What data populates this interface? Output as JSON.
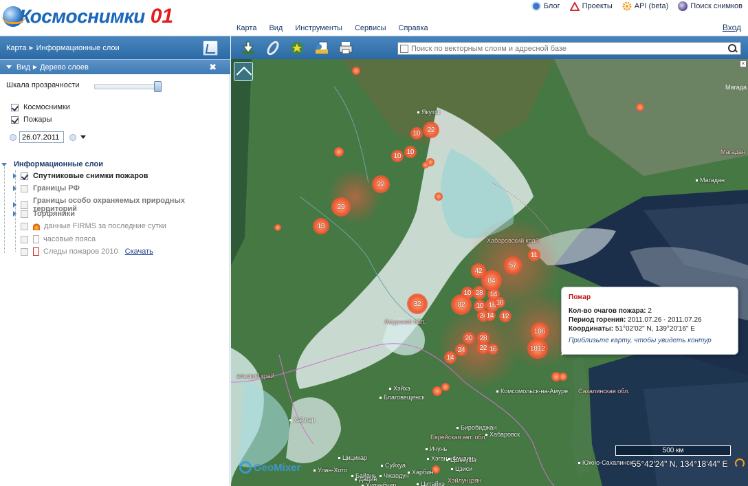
{
  "header": {
    "logo_text": "Космоснимки",
    "logo_number": "01",
    "links": [
      {
        "label": "Блог",
        "icon": "rss-icon",
        "color": "#3c78c8"
      },
      {
        "label": "Проекты",
        "icon": "triangle-icon",
        "color": "#d03030"
      },
      {
        "label": "API (beta)",
        "icon": "gear-icon",
        "color": "#f0a020"
      },
      {
        "label": "Поиск снимков",
        "icon": "globe-icon",
        "color": "#3060a0"
      }
    ],
    "menu": [
      "Карта",
      "Вид",
      "Инструменты",
      "Сервисы",
      "Справка"
    ],
    "exit_label": "Вход"
  },
  "left_panel": {
    "breadcrumb": [
      "Карта",
      "Информационные слои"
    ],
    "subheader": [
      "Вид",
      "Дерево слоев"
    ],
    "close_symbol": "✖",
    "transparency_label": "Шкала прозрачности",
    "transparency_value": 1.0,
    "base_layers": [
      {
        "label": "Космоснимки",
        "checked": true
      },
      {
        "label": "Пожары",
        "checked": true
      }
    ],
    "date_value": "26.07.2011",
    "tree_root": "Информационные слои",
    "layers": [
      {
        "label": "Спутниковые снимки пожаров",
        "checked": true,
        "bold": true,
        "expander": true
      },
      {
        "label": "Границы РФ",
        "checked": false,
        "bold": true,
        "expander": true
      },
      {
        "label": "Границы особо охраняемых природных территорий",
        "checked": false,
        "bold": true,
        "expander": true
      },
      {
        "label": "Торфяники",
        "checked": false,
        "bold": true,
        "expander": true
      },
      {
        "label": "данные FIRMS за последние сутки",
        "checked": false,
        "bold": false,
        "expander": false,
        "icon": "fire-icon"
      },
      {
        "label": "часовые пояса",
        "checked": false,
        "bold": false,
        "expander": false,
        "icon": "blank-swatch-icon"
      },
      {
        "label": "Следы пожаров 2010",
        "checked": false,
        "bold": false,
        "expander": false,
        "icon": "red-swatch-icon",
        "link": "Скачать"
      }
    ]
  },
  "map_toolbar": {
    "buttons": [
      "download-icon",
      "paperclip-icon",
      "star-icon",
      "export-icon",
      "print-icon"
    ],
    "search_placeholder": "Поиск по векторным слоям и адресной базе"
  },
  "map": {
    "labels": [
      {
        "text": "Якутск",
        "city": true
      },
      {
        "text": "Магадан",
        "city": true
      },
      {
        "text": "Магадан",
        "city": false
      },
      {
        "text": "Хабаровский край",
        "city": false
      },
      {
        "text": "Амурская обл.",
        "city": false
      },
      {
        "text": "Комсомольск-на-Амуре",
        "city": true
      },
      {
        "text": "Сахалинская обл.",
        "city": false
      },
      {
        "text": "Хэйхэ",
        "city": true
      },
      {
        "text": "Благовещенск",
        "city": true
      },
      {
        "text": "Хайлар",
        "city": true
      },
      {
        "text": "Биробиджан",
        "city": true
      },
      {
        "text": "Еврейская авт. обл.",
        "city": false
      },
      {
        "text": "Хабаровск",
        "city": true
      },
      {
        "text": "Цзямусы",
        "city": true
      },
      {
        "text": "Цицикар",
        "city": true
      },
      {
        "text": "Харбин",
        "city": true
      },
      {
        "text": "Дацин",
        "city": true
      },
      {
        "text": "Южно-Сахалинск",
        "city": true
      },
      {
        "text": "Ичунь",
        "city": true
      },
      {
        "text": "Хэган",
        "city": true
      },
      {
        "text": "Фуцзинь",
        "city": true
      },
      {
        "text": "Цзиси",
        "city": true
      },
      {
        "text": "Суйхуа",
        "city": true
      },
      {
        "text": "Чжаодун",
        "city": true
      },
      {
        "text": "Байань",
        "city": true
      },
      {
        "text": "Улан-Хото",
        "city": true
      },
      {
        "text": "Цитайхэ",
        "city": true
      },
      {
        "text": "Хулунбуир",
        "city": true
      },
      {
        "text": "Хэйлунцзян",
        "city": false
      },
      {
        "text": "альский край",
        "city": false
      }
    ],
    "fires": [
      {
        "label": "22"
      },
      {
        "label": "10"
      },
      {
        "label": "10"
      },
      {
        "label": "10"
      },
      {
        "label": "22"
      },
      {
        "label": "29"
      },
      {
        "label": "13"
      },
      {
        "label": "57"
      },
      {
        "label": "11"
      },
      {
        "label": "42"
      },
      {
        "label": "84"
      },
      {
        "label": "10"
      },
      {
        "label": "28"
      },
      {
        "label": "14"
      },
      {
        "label": "82"
      },
      {
        "label": "10"
      },
      {
        "label": "18"
      },
      {
        "label": "10"
      },
      {
        "label": "24"
      },
      {
        "label": "14"
      },
      {
        "label": "12"
      },
      {
        "label": "32"
      },
      {
        "label": "106"
      },
      {
        "label": "1812"
      },
      {
        "label": "20"
      },
      {
        "label": "28"
      },
      {
        "label": "24"
      },
      {
        "label": "22"
      },
      {
        "label": "16"
      },
      {
        "label": "14"
      }
    ],
    "popup": {
      "title": "Пожар",
      "count_label": "Кол-во очагов пожара:",
      "count_value": "2",
      "period_label": "Период горения:",
      "period_value": "2011.07.26 - 2011.07.26",
      "coords_label": "Координаты:",
      "coords_value": "51°02'02\" N, 139°20'16\" E",
      "hint": "Приблизьте карту, чтобы увидеть контур"
    },
    "scale_label": "500 км",
    "cursor_coords": "55°42'24\" N, 134°18'44\" E",
    "brand": "GeoMixer",
    "edge_label": "Магада",
    "close_symbol": "×"
  }
}
